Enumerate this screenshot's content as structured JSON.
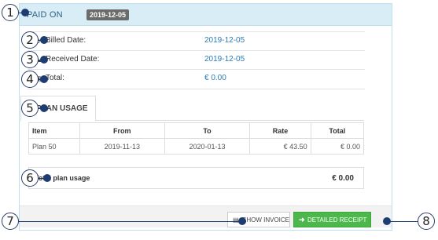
{
  "header": {
    "title": "PAID ON",
    "date_badge": "2019-12-05"
  },
  "info_rows": [
    {
      "icon": "clock-icon",
      "glyph": "⊙",
      "label": "Billed Date:",
      "value": "2019-12-05"
    },
    {
      "icon": "card-icon",
      "glyph": "▬",
      "label": "Received Date:",
      "value": "2019-12-05"
    },
    {
      "icon": "money-icon",
      "glyph": "▣",
      "label": "Total:",
      "value": "€ 0.00"
    }
  ],
  "tab": {
    "icon": "globe-icon",
    "glyph": "◕",
    "label": "PLAN USAGE"
  },
  "usage_table": {
    "columns": [
      "Item",
      "From",
      "To",
      "Rate",
      "Total"
    ],
    "rows": [
      {
        "item": "Plan 50",
        "from": "2019-11-13",
        "to": "2020-01-13",
        "rate": "€ 43.50",
        "total": "€ 0.00"
      }
    ]
  },
  "total_usage": {
    "label": "Total plan usage",
    "value": "€ 0.00"
  },
  "buttons": {
    "show_invoice": {
      "icon": "document-icon",
      "glyph": "▤",
      "label": "SHOW INVOICE"
    },
    "detailed_receipt": {
      "icon": "arrow-right-icon",
      "glyph": "➜",
      "label": "DETAILED RECEIPT"
    }
  },
  "callouts": [
    "1",
    "2",
    "3",
    "4",
    "5",
    "6",
    "7",
    "8"
  ],
  "colors": {
    "accent_blue": "#2a7bb6",
    "header_bg": "#d9edf7",
    "success_green": "#4cb84c",
    "callout_navy": "#1d3c72"
  }
}
